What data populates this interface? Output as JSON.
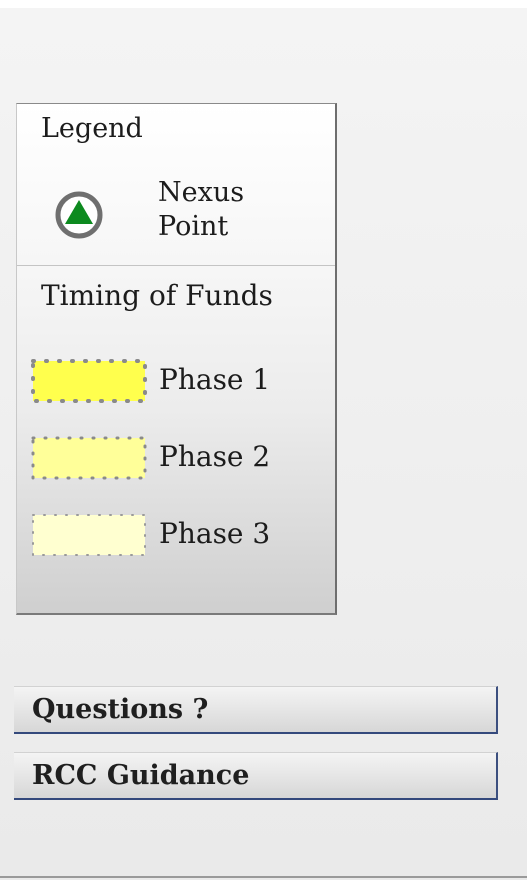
{
  "legend": {
    "title": "Legend",
    "nexus": {
      "label": "Nexus Point",
      "icon": "nexus-point-icon",
      "fill_color": "#0d8a1f",
      "ring_color": "#6f6f6f"
    }
  },
  "timing": {
    "title": "Timing of Funds",
    "phases": [
      {
        "label": "Phase 1",
        "color": "#ffff4d"
      },
      {
        "label": "Phase 2",
        "color": "#ffff99"
      },
      {
        "label": "Phase 3",
        "color": "#ffffd0"
      }
    ]
  },
  "buttons": {
    "questions": "Questions ?",
    "rcc_guidance": "RCC Guidance"
  }
}
